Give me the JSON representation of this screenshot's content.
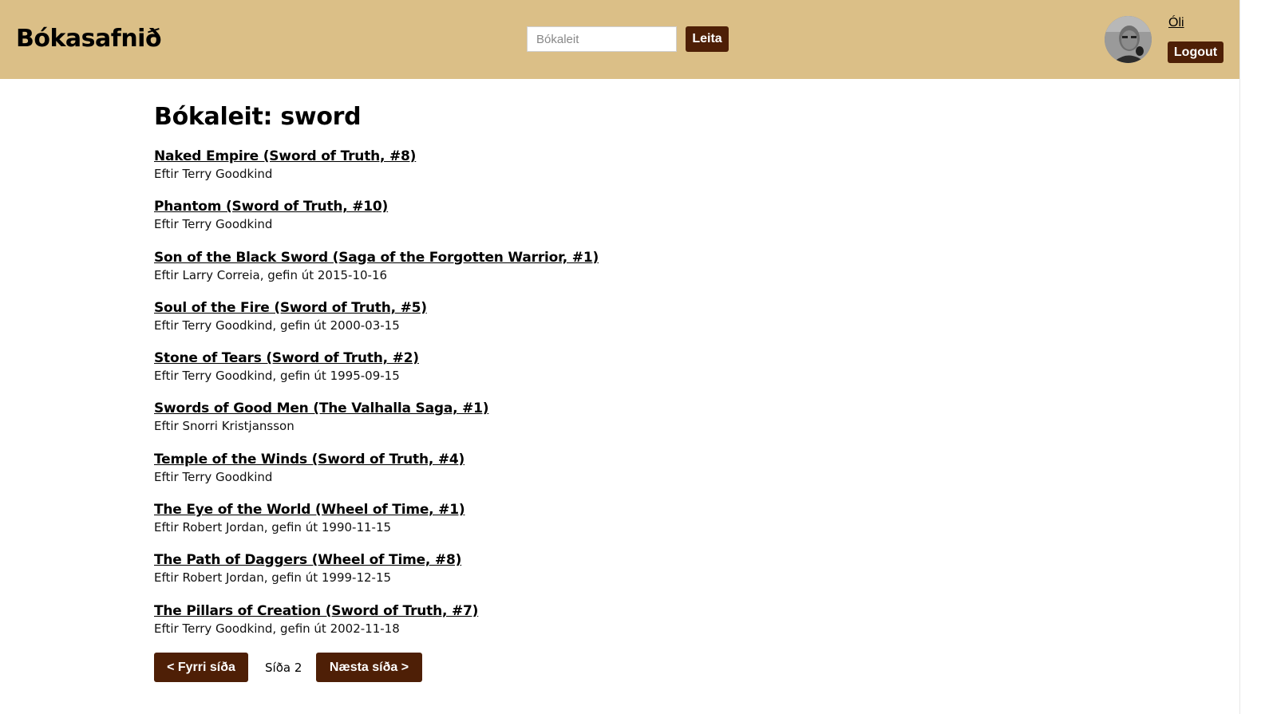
{
  "header": {
    "brand": "Bókasafnið",
    "search": {
      "placeholder": "Bókaleit",
      "value": ""
    },
    "search_button": "Leita",
    "user_name": "Óli",
    "logout_button": "Logout"
  },
  "main": {
    "title": "Bókaleit: sword",
    "results": [
      {
        "title": "Naked Empire (Sword of Truth, #8)",
        "meta": "Eftir Terry Goodkind"
      },
      {
        "title": "Phantom (Sword of Truth, #10)",
        "meta": "Eftir Terry Goodkind"
      },
      {
        "title": "Son of the Black Sword (Saga of the Forgotten Warrior, #1)",
        "meta": "Eftir Larry Correia, gefin út 2015-10-16"
      },
      {
        "title": "Soul of the Fire (Sword of Truth, #5)",
        "meta": "Eftir Terry Goodkind, gefin út 2000-03-15"
      },
      {
        "title": "Stone of Tears (Sword of Truth, #2)",
        "meta": "Eftir Terry Goodkind, gefin út 1995-09-15"
      },
      {
        "title": "Swords of Good Men (The Valhalla Saga, #1)",
        "meta": "Eftir Snorri Kristjansson"
      },
      {
        "title": "Temple of the Winds (Sword of Truth, #4)",
        "meta": "Eftir Terry Goodkind"
      },
      {
        "title": "The Eye of the World (Wheel of Time, #1)",
        "meta": "Eftir Robert Jordan, gefin út 1990-11-15"
      },
      {
        "title": "The Path of Daggers (Wheel of Time, #8)",
        "meta": "Eftir Robert Jordan, gefin út 1999-12-15"
      },
      {
        "title": "The Pillars of Creation (Sword of Truth, #7)",
        "meta": "Eftir Terry Goodkind, gefin út 2002-11-18"
      }
    ]
  },
  "pagination": {
    "prev_label": "< Fyrri síða",
    "page_label": "Síða 2",
    "next_label": "Næsta síða >"
  },
  "colors": {
    "header_bg": "#dbbf87",
    "button_bg": "#4e1f06"
  },
  "icons": {
    "avatar": "user-avatar-photo"
  }
}
